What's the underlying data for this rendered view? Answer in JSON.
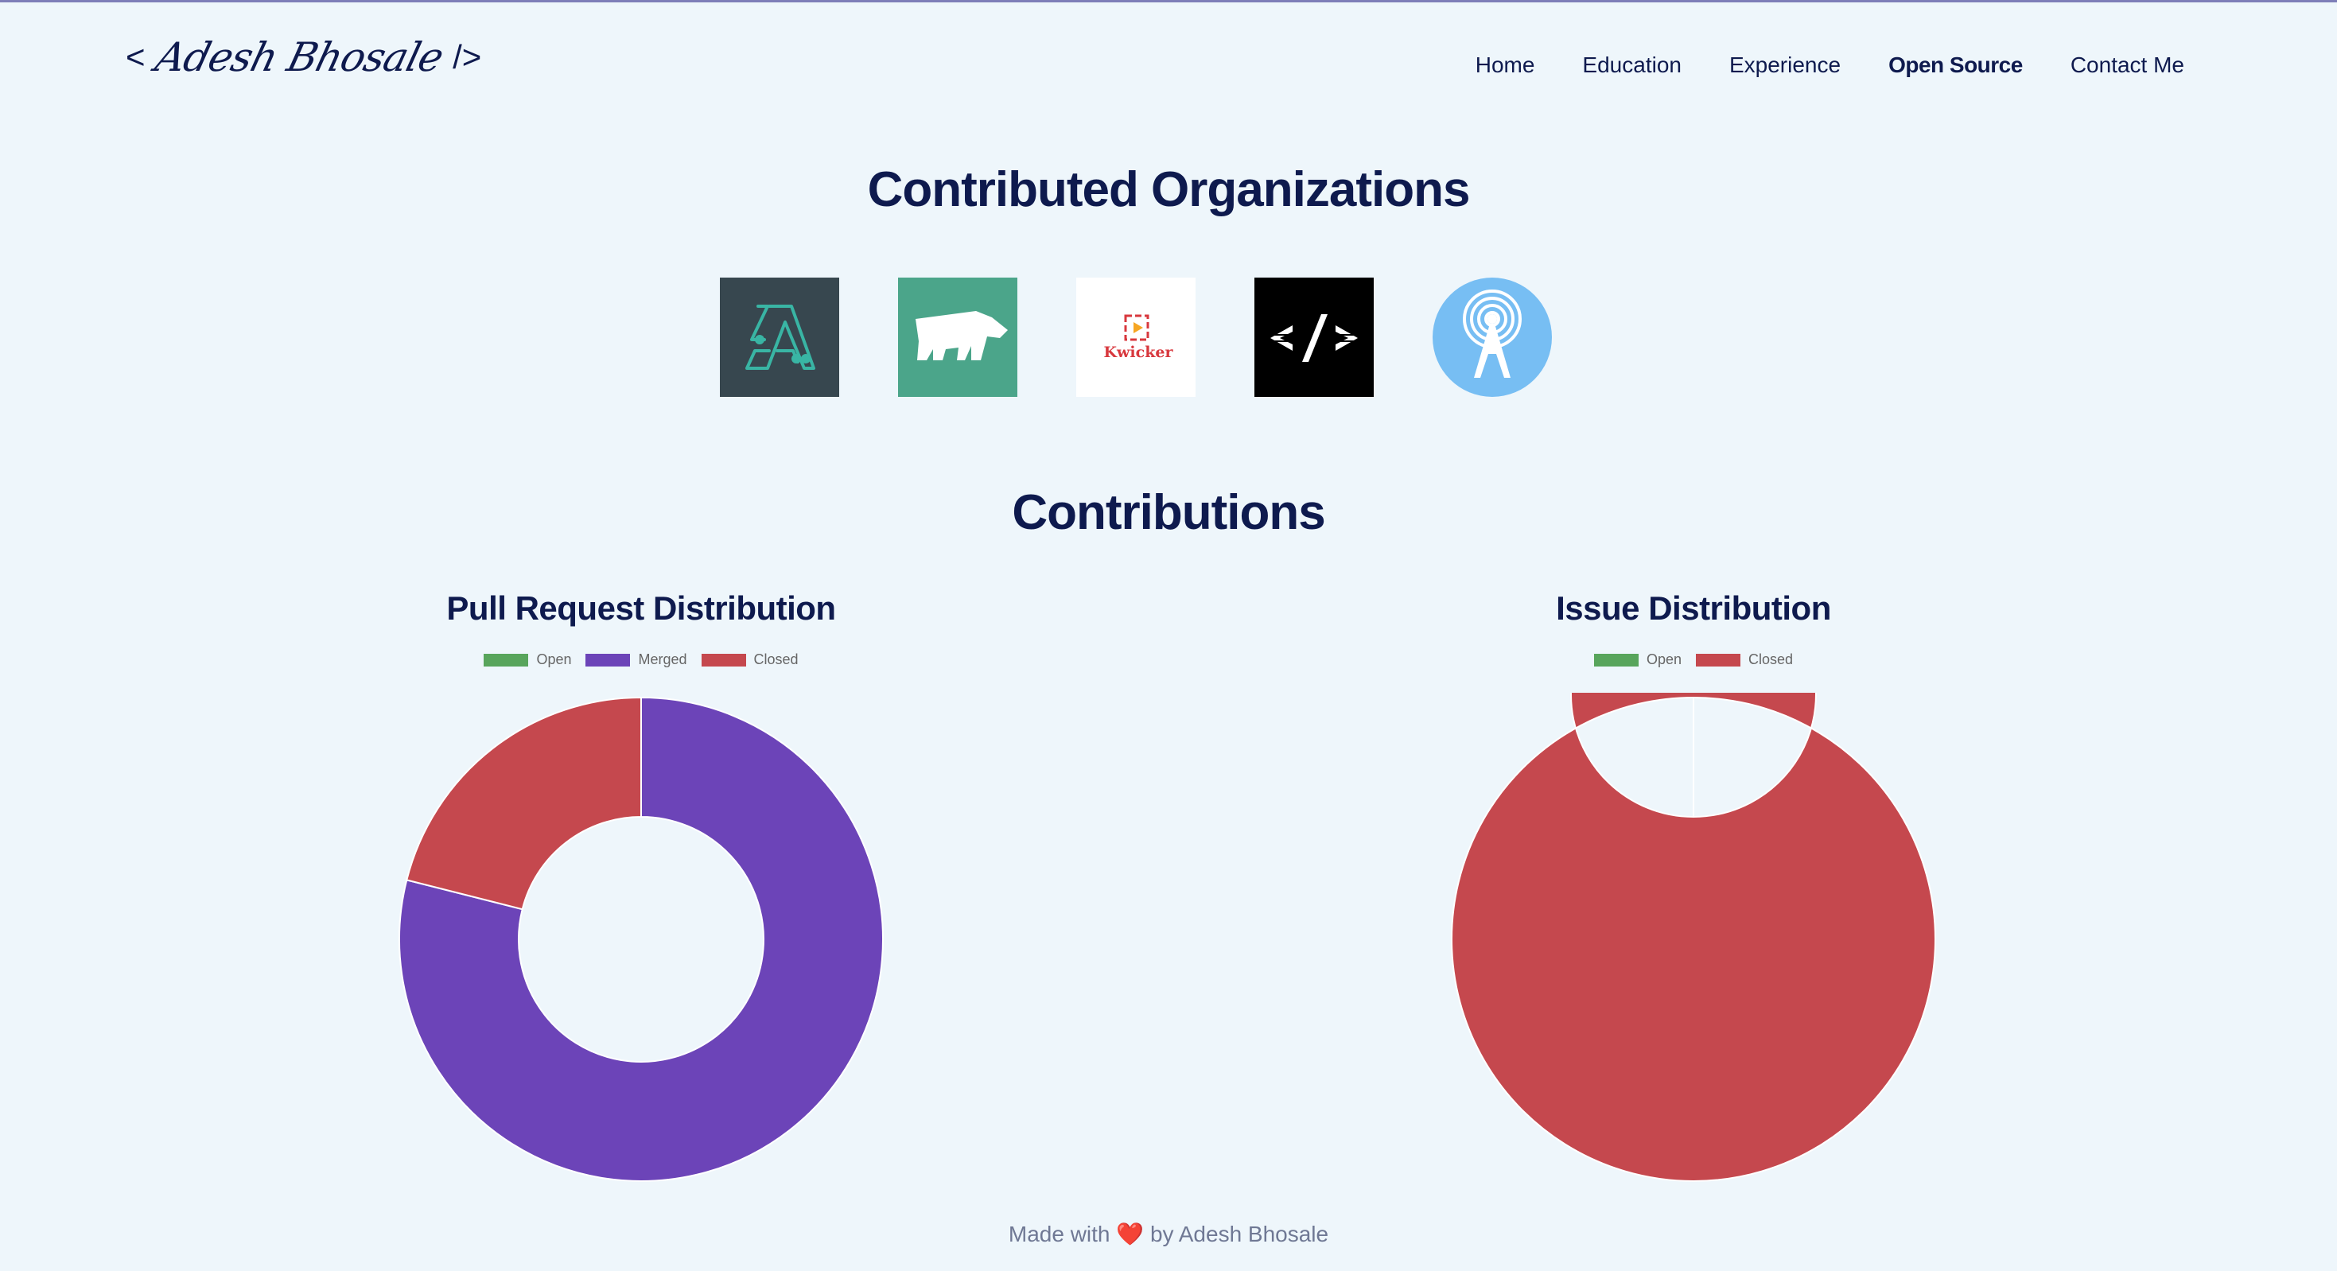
{
  "header": {
    "logo": {
      "open": "<",
      "name": "Adesh Bhosale",
      "close": "/>"
    },
    "nav": [
      {
        "label": "Home",
        "active": false
      },
      {
        "label": "Education",
        "active": false
      },
      {
        "label": "Experience",
        "active": false
      },
      {
        "label": "Open Source",
        "active": true
      },
      {
        "label": "Contact Me",
        "active": false
      }
    ]
  },
  "organizations": {
    "title": "Contributed Organizations",
    "items": [
      {
        "icon": "circuit-a-logo-icon",
        "bg": "#37474f"
      },
      {
        "icon": "polar-bear-logo-icon",
        "bg": "#4ba58a"
      },
      {
        "icon": "kwicker-logo-icon",
        "bg": "#ffffff",
        "text": "Kwicker"
      },
      {
        "icon": "code-brackets-logo-icon",
        "bg": "#000000"
      },
      {
        "icon": "radio-tower-logo-icon",
        "bg": "#77bef3"
      }
    ]
  },
  "contributions": {
    "title": "Contributions"
  },
  "chart_data": [
    {
      "type": "pie",
      "title": "Pull Request Distribution",
      "categories": [
        "Open",
        "Merged",
        "Closed"
      ],
      "values": [
        0,
        15,
        4
      ],
      "colors": [
        "#58a55c",
        "#6c44b8",
        "#c5484e"
      ],
      "legend": "top"
    },
    {
      "type": "pie",
      "title": "Issue Distribution",
      "categories": [
        "Open",
        "Closed"
      ],
      "values": [
        0,
        1
      ],
      "colors": [
        "#58a55c",
        "#c5484e"
      ],
      "legend": "top"
    }
  ],
  "footer": {
    "prefix": "Made with",
    "heart": "❤️",
    "suffix": "by Adesh Bhosale"
  }
}
